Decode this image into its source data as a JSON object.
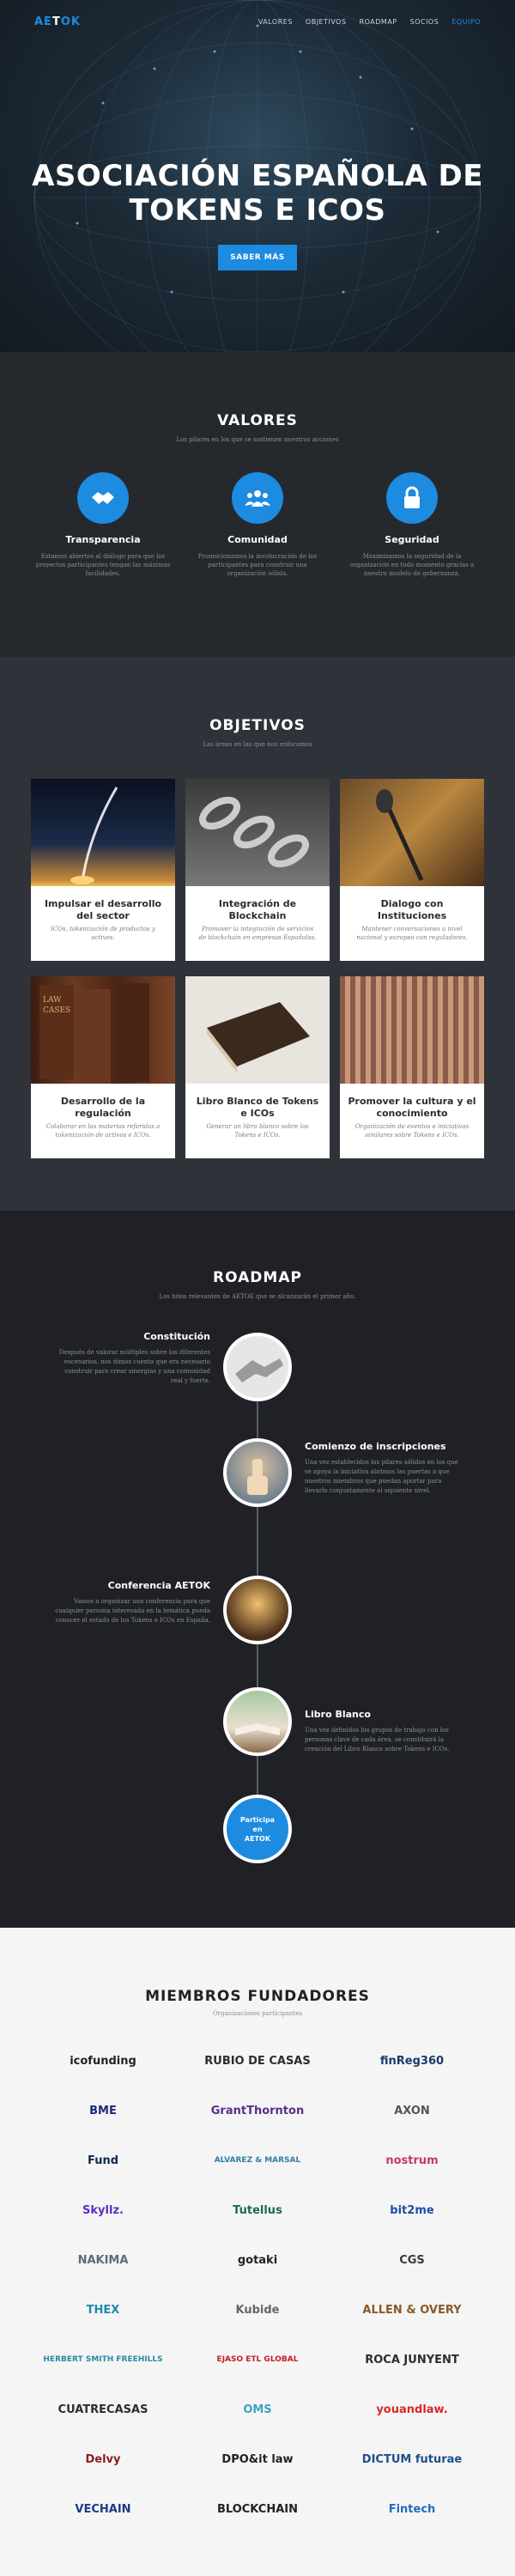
{
  "nav": {
    "logo_a": "AE",
    "logo_b": "T",
    "logo_c": "OK",
    "items": [
      "VALORES",
      "OBJETIVOS",
      "ROADMAP",
      "SOCIOS",
      "EQUIPO"
    ]
  },
  "hero": {
    "title_line1": "ASOCIACIÓN ESPAÑOLA DE",
    "title_line2": "TOKENS E ICOS",
    "button": "SABER MÁS"
  },
  "valores": {
    "title": "VALORES",
    "subtitle": "Los pilares en los que se sostienen nuestras acciones",
    "items": [
      {
        "icon": "handshake-icon",
        "title": "Transparencia",
        "text": "Estamos abiertos al diálogo para que los proyectos participantes tengan las máximas facilidades."
      },
      {
        "icon": "community-icon",
        "title": "Comunidad",
        "text": "Promocionamos la involucración de los participantes para construir una organización sólida."
      },
      {
        "icon": "lock-icon",
        "title": "Seguridad",
        "text": "Maximizamos la seguridad de la organización en todo momento gracias a nuestro modelo de gobernanza."
      }
    ]
  },
  "objetivos": {
    "title": "OBJETIVOS",
    "subtitle": "Las áreas en las que nos enfocamos",
    "cards": [
      {
        "image": "rocket-launch",
        "title": "Impulsar el desarrollo del sector",
        "text": "ICOs, tokenización de productos y activos."
      },
      {
        "image": "chain-links",
        "title": "Integración de Blockchain",
        "text": "Promover la integración de servicios de blockchain en empresas Españolas."
      },
      {
        "image": "microphone",
        "title": "Dialogo con Instituciones",
        "text": "Mantener conversaciones a nivel nacional y europeo con reguladores."
      },
      {
        "image": "law-books",
        "title": "Desarrollo de la regulación",
        "text": "Colaborar en las materias referidas a tokenización de activos e ICOs."
      },
      {
        "image": "white-book",
        "title": "Libro Blanco de Tokens e ICOs",
        "text": "Generar un libro blanco sobre los Tokens e ICOs."
      },
      {
        "image": "audience",
        "title": "Promover la cultura y el conocimiento",
        "text": "Organización de eventos e iniciativas similares sobre Tokens e ICOs."
      }
    ]
  },
  "roadmap": {
    "title": "ROADMAP",
    "subtitle": "Los hitos relevantes de AETOK que se alcanzarán el primer año.",
    "milestones": [
      {
        "image": "handshake",
        "title": "Constitución",
        "text": "Después de valorar múltiples sobre los diferentes escenarios, nos dimos cuenta que era necesario construir para crear sinergias y una comunidad real y fuerte."
      },
      {
        "image": "thumbs-up",
        "title": "Comienzo de inscripciones",
        "text": "Una vez establecidos los pilares sólidos en los que se apoya la iniciativa abrimos las puertas a que nuestros miembros que puedan aportar para llevarlo conjuntamente al siguiente nivel."
      },
      {
        "image": "conference",
        "title": "Conferencia AETOK",
        "text": "Vamos a organizar una conferencia para que cualquier persona interesada en la temática pueda conocer el estado de los Tokens e ICOs en España."
      },
      {
        "image": "open-book",
        "title": "Libro Blanco",
        "text": "Una vez definidos los grupos de trabajo con los personas clave de cada área, se constituirá la creación del Libro Blanco sobre Tokens e ICOs."
      }
    ],
    "final_line1": "Participa",
    "final_line2": "en",
    "final_line3": "AETOK"
  },
  "miembros": {
    "title": "MIEMBROS FUNDADORES",
    "subtitle": "Organizaciones participantes",
    "logos": [
      {
        "name": "icofunding",
        "color": "#1f2126"
      },
      {
        "name": "RUBIO DE CASAS",
        "color": "#2a2d33"
      },
      {
        "name": "finReg360",
        "color": "#1b3a6b"
      },
      {
        "name": "BME",
        "color": "#1b2b7a"
      },
      {
        "name": "GrantThornton",
        "color": "#5b2d8c"
      },
      {
        "name": "AXON",
        "color": "#555"
      },
      {
        "name": "Fund",
        "color": "#0e2a47"
      },
      {
        "name": "ALVAREZ & MARSAL",
        "color": "#2e7fa8"
      },
      {
        "name": "nostrum",
        "color": "#c23a6b"
      },
      {
        "name": "Skyllz.",
        "color": "#5a2fc4"
      },
      {
        "name": "Tutellus",
        "color": "#1d6b4f"
      },
      {
        "name": "bit2me",
        "color": "#1d4fa3"
      },
      {
        "name": "NAKIMA",
        "color": "#5c6b7a"
      },
      {
        "name": "gotaki",
        "color": "#1f2126"
      },
      {
        "name": "CGS",
        "color": "#3a3a3a"
      },
      {
        "name": "THEX",
        "color": "#1d8ab0"
      },
      {
        "name": "Kubide",
        "color": "#666"
      },
      {
        "name": "ALLEN & OVERY",
        "color": "#8a5a2a"
      },
      {
        "name": "HERBERT SMITH FREEHILLS",
        "color": "#2a8aa3"
      },
      {
        "name": "EJASO ETL GLOBAL",
        "color": "#c21d2a"
      },
      {
        "name": "ROCA JUNYENT",
        "color": "#2a2d33"
      },
      {
        "name": "CUATRECASAS",
        "color": "#2a2d33"
      },
      {
        "name": "OMS",
        "color": "#3aa3c4"
      },
      {
        "name": "youandlaw.",
        "color": "#d62a2a"
      },
      {
        "name": "Delvy",
        "color": "#8a1d1d"
      },
      {
        "name": "DPO&it law",
        "color": "#1f2126"
      },
      {
        "name": "DICTUM futurae",
        "color": "#1d4f8a"
      },
      {
        "name": "VECHAIN",
        "color": "#1d3a8a"
      },
      {
        "name": "BLOCKCHAIN",
        "color": "#1f2126"
      },
      {
        "name": "Fintech",
        "color": "#1d6bc4"
      }
    ]
  }
}
